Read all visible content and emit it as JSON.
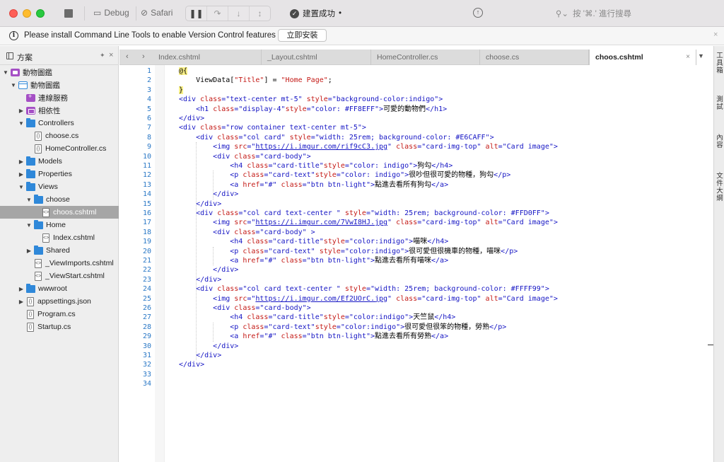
{
  "toolbar": {
    "run_target": "Debug",
    "run_device": "Safari",
    "build_status": "建置成功",
    "build_status_dot": "•",
    "search_shortcut": "按 '⌘.' 進行搜尋"
  },
  "notification": {
    "message": "Please install Command Line Tools to enable Version Control features",
    "button_label": "立即安裝"
  },
  "sidebar": {
    "title": "方案",
    "items": [
      {
        "label": "動物圖鑑",
        "icon": "solution-icon",
        "level": 0,
        "caret": "▼"
      },
      {
        "label": "動物圖鑑",
        "icon": "project-icon",
        "level": 1,
        "caret": "▼"
      },
      {
        "label": "連線服務",
        "icon": "connected-services-icon",
        "level": 2,
        "caret": ""
      },
      {
        "label": "相依性",
        "icon": "dependencies-icon",
        "level": 2,
        "caret": "▶"
      },
      {
        "label": "Controllers",
        "icon": "folder-icon",
        "level": 2,
        "caret": "▼"
      },
      {
        "label": "choose.cs",
        "icon": "cs-file-icon",
        "level": 3,
        "caret": ""
      },
      {
        "label": "HomeController.cs",
        "icon": "cs-file-icon",
        "level": 3,
        "caret": ""
      },
      {
        "label": "Models",
        "icon": "folder-icon",
        "level": 2,
        "caret": "▶"
      },
      {
        "label": "Properties",
        "icon": "folder-icon",
        "level": 2,
        "caret": "▶"
      },
      {
        "label": "Views",
        "icon": "folder-icon",
        "level": 2,
        "caret": "▼"
      },
      {
        "label": "choose",
        "icon": "folder-icon",
        "level": 3,
        "caret": "▼"
      },
      {
        "label": "choos.cshtml",
        "icon": "cshtml-file-icon",
        "level": 4,
        "caret": "",
        "selected": true
      },
      {
        "label": "Home",
        "icon": "folder-icon",
        "level": 3,
        "caret": "▼"
      },
      {
        "label": "Index.cshtml",
        "icon": "cshtml-file-icon",
        "level": 4,
        "caret": ""
      },
      {
        "label": "Shared",
        "icon": "folder-icon",
        "level": 3,
        "caret": "▶"
      },
      {
        "label": "_ViewImports.cshtml",
        "icon": "cshtml-file-icon",
        "level": 3,
        "caret": ""
      },
      {
        "label": "_ViewStart.cshtml",
        "icon": "cshtml-file-icon",
        "level": 3,
        "caret": ""
      },
      {
        "label": "wwwroot",
        "icon": "folder-icon",
        "level": 2,
        "caret": "▶"
      },
      {
        "label": "appsettings.json",
        "icon": "json-file-icon",
        "level": 2,
        "caret": "▶"
      },
      {
        "label": "Program.cs",
        "icon": "cs-file-icon",
        "level": 2,
        "caret": ""
      },
      {
        "label": "Startup.cs",
        "icon": "cs-file-icon",
        "level": 2,
        "caret": ""
      }
    ]
  },
  "tabs": [
    {
      "label": "Index.cshtml",
      "active": false
    },
    {
      "label": "_Layout.cshtml",
      "active": false
    },
    {
      "label": "HomeController.cs",
      "active": false
    },
    {
      "label": "choose.cs",
      "active": false
    },
    {
      "label": "choos.cshtml",
      "active": true
    }
  ],
  "editor": {
    "lines": [
      [
        [
          "at",
          "@{"
        ]
      ],
      [
        [
          "pl",
          "    ViewData["
        ],
        [
          "sr",
          "\"Title\""
        ],
        [
          "pl",
          "] = "
        ],
        [
          "sr",
          "\"Home Page\""
        ],
        [
          "pl",
          ";"
        ]
      ],
      [
        [
          "at",
          "}"
        ]
      ],
      [
        [
          "k",
          "<div "
        ],
        [
          "a",
          "class"
        ],
        [
          "k",
          "="
        ],
        [
          "s",
          "\"text-center mt-5\" "
        ],
        [
          "a",
          "style"
        ],
        [
          "k",
          "="
        ],
        [
          "s",
          "\"background-color:indigo\""
        ],
        [
          "k",
          ">"
        ]
      ],
      [
        [
          "pl",
          "    "
        ],
        [
          "k",
          "<h1 "
        ],
        [
          "a",
          "class"
        ],
        [
          "k",
          "="
        ],
        [
          "s",
          "\"display-4\""
        ],
        [
          "a",
          "style"
        ],
        [
          "k",
          "="
        ],
        [
          "s",
          "\"color: #FF8EFF\""
        ],
        [
          "k",
          ">"
        ],
        [
          "pl",
          "可愛的動物們"
        ],
        [
          "k",
          "</h1>"
        ]
      ],
      [
        [
          "k",
          "</div>"
        ]
      ],
      [
        [
          "k",
          "<div "
        ],
        [
          "a",
          "class"
        ],
        [
          "k",
          "="
        ],
        [
          "s",
          "\"row container text-center mt-5\""
        ],
        [
          "k",
          ">"
        ]
      ],
      [
        [
          "pl",
          "    "
        ],
        [
          "k",
          "<div "
        ],
        [
          "a",
          "class"
        ],
        [
          "k",
          "="
        ],
        [
          "s",
          "\"col card\" "
        ],
        [
          "a",
          "style"
        ],
        [
          "k",
          "="
        ],
        [
          "s",
          "\"width: 25rem; background-color: #E6CAFF\""
        ],
        [
          "k",
          ">"
        ]
      ],
      [
        [
          "pl",
          "        "
        ],
        [
          "k",
          "<img "
        ],
        [
          "a",
          "src"
        ],
        [
          "k",
          "="
        ],
        [
          "s",
          "\""
        ],
        [
          "u",
          "https://i.imgur.com/rif9cC3.jpg"
        ],
        [
          "s",
          "\" "
        ],
        [
          "a",
          "class"
        ],
        [
          "k",
          "="
        ],
        [
          "s",
          "\"card-img-top\" "
        ],
        [
          "a",
          "alt"
        ],
        [
          "k",
          "="
        ],
        [
          "s",
          "\"Card image\""
        ],
        [
          "k",
          ">"
        ]
      ],
      [
        [
          "pl",
          "        "
        ],
        [
          "k",
          "<div "
        ],
        [
          "a",
          "class"
        ],
        [
          "k",
          "="
        ],
        [
          "s",
          "\"card-body\""
        ],
        [
          "k",
          ">"
        ]
      ],
      [
        [
          "pl",
          "            "
        ],
        [
          "k",
          "<h4 "
        ],
        [
          "a",
          "class"
        ],
        [
          "k",
          "="
        ],
        [
          "s",
          "\"card-title\""
        ],
        [
          "a",
          "style"
        ],
        [
          "k",
          "="
        ],
        [
          "s",
          "\"color: indigo\""
        ],
        [
          "k",
          ">"
        ],
        [
          "pl",
          "狗勾"
        ],
        [
          "k",
          "</h4>"
        ]
      ],
      [
        [
          "pl",
          "            "
        ],
        [
          "k",
          "<p "
        ],
        [
          "a",
          "class"
        ],
        [
          "k",
          "="
        ],
        [
          "s",
          "\"card-text\""
        ],
        [
          "a",
          "style"
        ],
        [
          "k",
          "="
        ],
        [
          "s",
          "\"color: indigo\""
        ],
        [
          "k",
          ">"
        ],
        [
          "pl",
          "很吵但很可愛的物種，狗勾"
        ],
        [
          "k",
          "</p>"
        ]
      ],
      [
        [
          "pl",
          "            "
        ],
        [
          "k",
          "<a "
        ],
        [
          "a",
          "href"
        ],
        [
          "k",
          "="
        ],
        [
          "s",
          "\"#\" "
        ],
        [
          "a",
          "class"
        ],
        [
          "k",
          "="
        ],
        [
          "s",
          "\"btn btn-light\""
        ],
        [
          "k",
          ">"
        ],
        [
          "pl",
          "點進去看所有狗勾"
        ],
        [
          "k",
          "</a>"
        ]
      ],
      [
        [
          "pl",
          "        "
        ],
        [
          "k",
          "</div>"
        ]
      ],
      [
        [
          "pl",
          "    "
        ],
        [
          "k",
          "</div>"
        ]
      ],
      [
        [
          "pl",
          "    "
        ],
        [
          "k",
          "<div "
        ],
        [
          "a",
          "class"
        ],
        [
          "k",
          "="
        ],
        [
          "s",
          "\"col card text-center \" "
        ],
        [
          "a",
          "style"
        ],
        [
          "k",
          "="
        ],
        [
          "s",
          "\"width: 25rem; background-color: #FFD0FF\""
        ],
        [
          "k",
          ">"
        ]
      ],
      [
        [
          "pl",
          "        "
        ],
        [
          "k",
          "<img "
        ],
        [
          "a",
          "src"
        ],
        [
          "k",
          "="
        ],
        [
          "s",
          "\""
        ],
        [
          "u",
          "https://i.imgur.com/7VwI8HJ.jpg"
        ],
        [
          "s",
          "\" "
        ],
        [
          "a",
          "class"
        ],
        [
          "k",
          "="
        ],
        [
          "s",
          "\"card-img-top\" "
        ],
        [
          "a",
          "alt"
        ],
        [
          "k",
          "="
        ],
        [
          "s",
          "\"Card image\""
        ],
        [
          "k",
          ">"
        ]
      ],
      [
        [
          "pl",
          "        "
        ],
        [
          "k",
          "<div "
        ],
        [
          "a",
          "class"
        ],
        [
          "k",
          "="
        ],
        [
          "s",
          "\"card-body\" "
        ],
        [
          "k",
          ">"
        ]
      ],
      [
        [
          "pl",
          "            "
        ],
        [
          "k",
          "<h4 "
        ],
        [
          "a",
          "class"
        ],
        [
          "k",
          "="
        ],
        [
          "s",
          "\"card-title\""
        ],
        [
          "a",
          "style"
        ],
        [
          "k",
          "="
        ],
        [
          "s",
          "\"color:indigo\""
        ],
        [
          "k",
          ">"
        ],
        [
          "pl",
          "喵咪"
        ],
        [
          "k",
          "</h4>"
        ]
      ],
      [
        [
          "pl",
          "            "
        ],
        [
          "k",
          "<p "
        ],
        [
          "a",
          "class"
        ],
        [
          "k",
          "="
        ],
        [
          "s",
          "\"card-text\" "
        ],
        [
          "a",
          "style"
        ],
        [
          "k",
          "="
        ],
        [
          "s",
          "\"color:indigo\""
        ],
        [
          "k",
          ">"
        ],
        [
          "pl",
          "很可愛但很機車的物種，喵咪"
        ],
        [
          "k",
          "</p>"
        ]
      ],
      [
        [
          "pl",
          "            "
        ],
        [
          "k",
          "<a "
        ],
        [
          "a",
          "href"
        ],
        [
          "k",
          "="
        ],
        [
          "s",
          "\"#\" "
        ],
        [
          "a",
          "class"
        ],
        [
          "k",
          "="
        ],
        [
          "s",
          "\"btn btn-light\""
        ],
        [
          "k",
          ">"
        ],
        [
          "pl",
          "點進去看所有喵咪"
        ],
        [
          "k",
          "</a>"
        ]
      ],
      [
        [
          "pl",
          "        "
        ],
        [
          "k",
          "</div>"
        ]
      ],
      [
        [
          "pl",
          "    "
        ],
        [
          "k",
          "</div>"
        ]
      ],
      [
        [
          "pl",
          "    "
        ],
        [
          "k",
          "<div "
        ],
        [
          "a",
          "class"
        ],
        [
          "k",
          "="
        ],
        [
          "s",
          "\"col card text-center \" "
        ],
        [
          "a",
          "style"
        ],
        [
          "k",
          "="
        ],
        [
          "s",
          "\"width: 25rem; background-color: #FFFF99\""
        ],
        [
          "k",
          ">"
        ]
      ],
      [
        [
          "pl",
          "        "
        ],
        [
          "k",
          "<img "
        ],
        [
          "a",
          "src"
        ],
        [
          "k",
          "="
        ],
        [
          "s",
          "\""
        ],
        [
          "u",
          "https://i.imgur.com/Ef2UOrC.jpg"
        ],
        [
          "s",
          "\" "
        ],
        [
          "a",
          "class"
        ],
        [
          "k",
          "="
        ],
        [
          "s",
          "\"card-img-top\" "
        ],
        [
          "a",
          "alt"
        ],
        [
          "k",
          "="
        ],
        [
          "s",
          "\"Card image\""
        ],
        [
          "k",
          ">"
        ]
      ],
      [
        [
          "pl",
          "        "
        ],
        [
          "k",
          "<div "
        ],
        [
          "a",
          "class"
        ],
        [
          "k",
          "="
        ],
        [
          "s",
          "\"card-body\""
        ],
        [
          "k",
          ">"
        ]
      ],
      [
        [
          "pl",
          "            "
        ],
        [
          "k",
          "<h4 "
        ],
        [
          "a",
          "class"
        ],
        [
          "k",
          "="
        ],
        [
          "s",
          "\"card-title\""
        ],
        [
          "a",
          "style"
        ],
        [
          "k",
          "="
        ],
        [
          "s",
          "\"color:indigo\""
        ],
        [
          "k",
          ">"
        ],
        [
          "pl",
          "天竺鼠"
        ],
        [
          "k",
          "</h4>"
        ]
      ],
      [
        [
          "pl",
          "            "
        ],
        [
          "k",
          "<p "
        ],
        [
          "a",
          "class"
        ],
        [
          "k",
          "="
        ],
        [
          "s",
          "\"card-text\""
        ],
        [
          "a",
          "style"
        ],
        [
          "k",
          "="
        ],
        [
          "s",
          "\"color:indigo\""
        ],
        [
          "k",
          ">"
        ],
        [
          "pl",
          "很可愛但很笨的物種，勞熟"
        ],
        [
          "k",
          "</p>"
        ]
      ],
      [
        [
          "pl",
          "            "
        ],
        [
          "k",
          "<a "
        ],
        [
          "a",
          "href"
        ],
        [
          "k",
          "="
        ],
        [
          "s",
          "\"#\" "
        ],
        [
          "a",
          "class"
        ],
        [
          "k",
          "="
        ],
        [
          "s",
          "\"btn btn-light\""
        ],
        [
          "k",
          ">"
        ],
        [
          "pl",
          "點進去看所有勞熟"
        ],
        [
          "k",
          "</a>"
        ]
      ],
      [
        [
          "pl",
          "        "
        ],
        [
          "k",
          "</div>"
        ]
      ],
      [
        [
          "pl",
          "    "
        ],
        [
          "k",
          "</div>"
        ]
      ],
      [
        [
          "k",
          "</div>"
        ]
      ],
      [],
      []
    ]
  },
  "right_panel": {
    "items": [
      "工具箱",
      "測試",
      "內容",
      "文件大綱"
    ]
  }
}
